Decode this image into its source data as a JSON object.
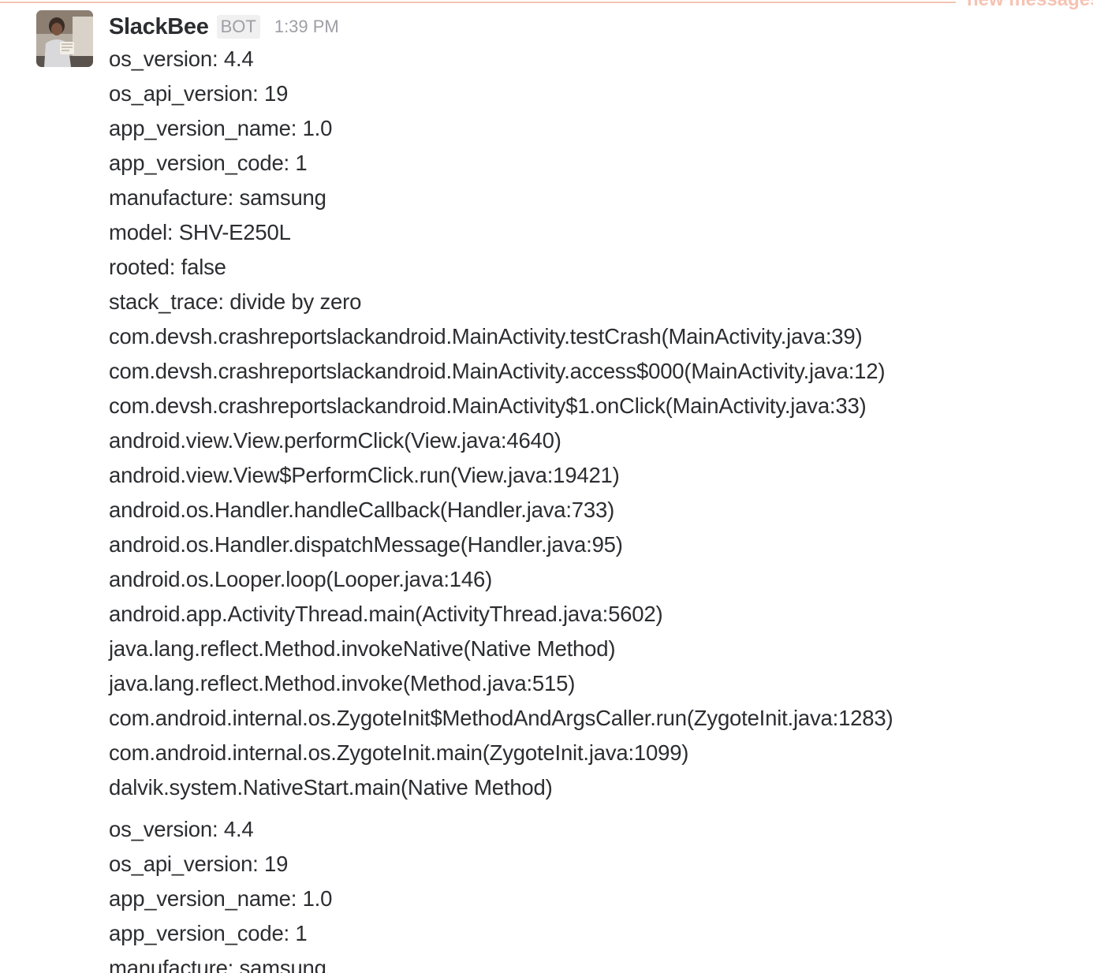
{
  "divider": {
    "label": "new messages"
  },
  "message": {
    "sender": "SlackBee",
    "badge": "BOT",
    "time": "1:39 PM",
    "avatar_icon": "user-photo-avatar"
  },
  "report1": {
    "lines": [
      "os_version: 4.4",
      "os_api_version: 19",
      "app_version_name: 1.0",
      "app_version_code: 1",
      "manufacture: samsung",
      "model: SHV-E250L",
      "rooted: false",
      "stack_trace: divide by zero",
      "com.devsh.crashreportslackandroid.MainActivity.testCrash(MainActivity.java:39)",
      "com.devsh.crashreportslackandroid.MainActivity.access$000(MainActivity.java:12)",
      "com.devsh.crashreportslackandroid.MainActivity$1.onClick(MainActivity.java:33)",
      "android.view.View.performClick(View.java:4640)",
      "android.view.View$PerformClick.run(View.java:19421)",
      "android.os.Handler.handleCallback(Handler.java:733)",
      "android.os.Handler.dispatchMessage(Handler.java:95)",
      "android.os.Looper.loop(Looper.java:146)",
      "android.app.ActivityThread.main(ActivityThread.java:5602)",
      "java.lang.reflect.Method.invokeNative(Native Method)",
      "java.lang.reflect.Method.invoke(Method.java:515)",
      "com.android.internal.os.ZygoteInit$MethodAndArgsCaller.run(ZygoteInit.java:1283)",
      "com.android.internal.os.ZygoteInit.main(ZygoteInit.java:1099)",
      "dalvik.system.NativeStart.main(Native Method)"
    ]
  },
  "report2": {
    "lines": [
      "os_version: 4.4",
      "os_api_version: 19",
      "app_version_name: 1.0",
      "app_version_code: 1",
      "manufacture: samsung"
    ]
  },
  "colors": {
    "divider": "#f5c3b3",
    "text": "#2c2d30",
    "muted": "#9e9ea6"
  }
}
